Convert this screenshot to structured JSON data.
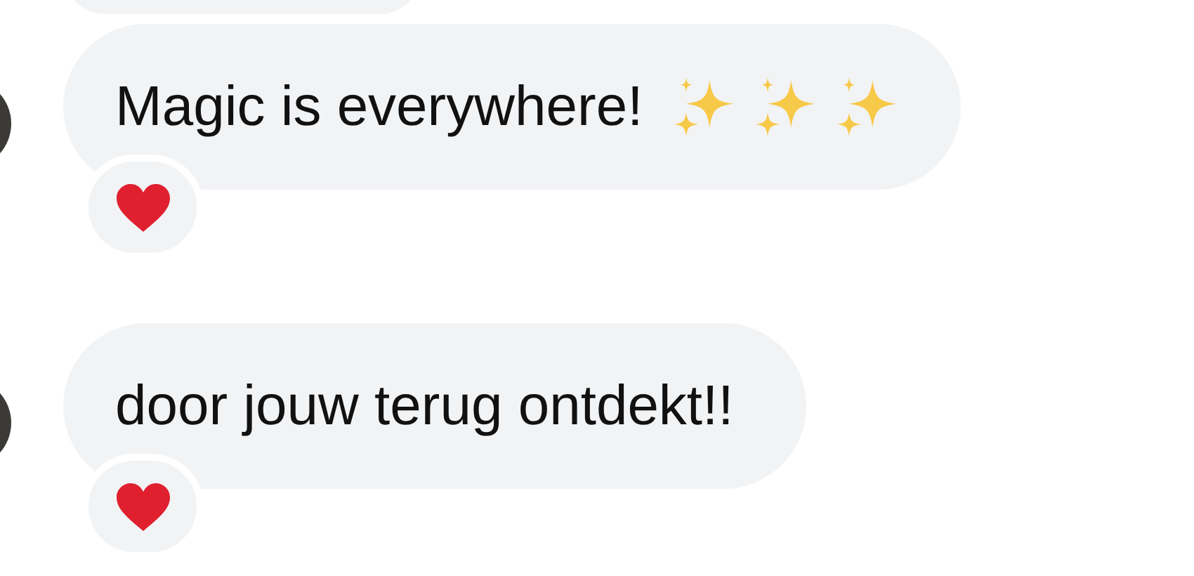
{
  "partial_bubble_above": true,
  "messages": [
    {
      "text": "Magic is everywhere!",
      "trailing_icons": [
        {
          "kind": "sparkles"
        },
        {
          "kind": "sparkles"
        },
        {
          "kind": "sparkles"
        }
      ],
      "reaction": {
        "kind": "heart"
      }
    },
    {
      "text": "door jouw terug ontdekt!!",
      "reaction": {
        "kind": "heart"
      }
    }
  ]
}
